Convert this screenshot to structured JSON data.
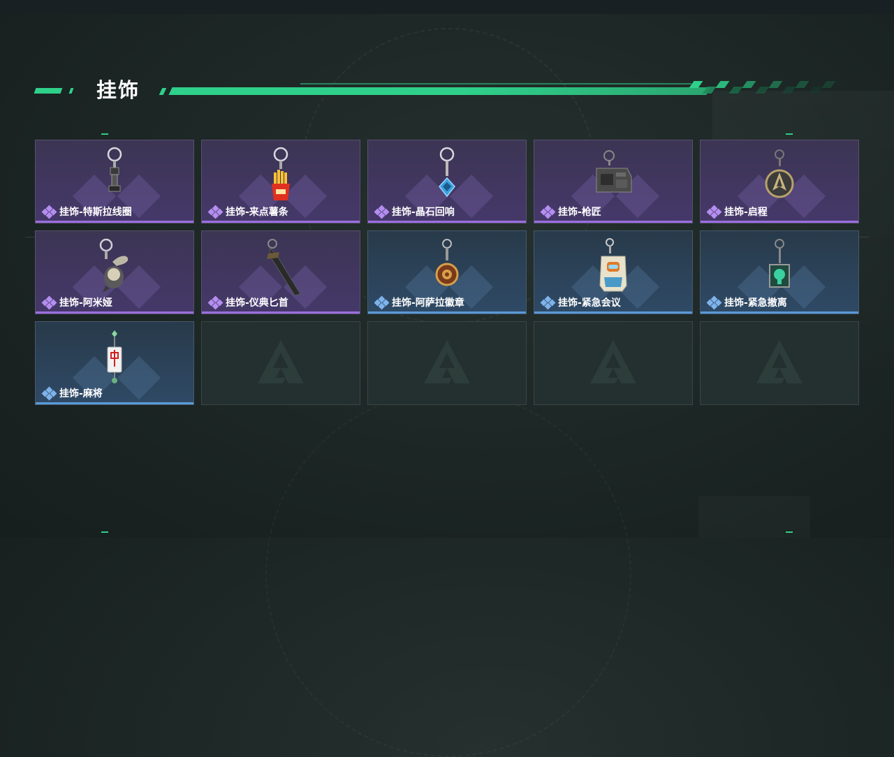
{
  "header": {
    "title": "挂饰",
    "accent": "#2fd08a"
  },
  "items": [
    {
      "name": "挂饰-特斯拉线圈",
      "rarity": "purple",
      "icon": "tesla-coil-charm-icon"
    },
    {
      "name": "挂饰-来点薯条",
      "rarity": "purple",
      "icon": "fries-charm-icon"
    },
    {
      "name": "挂饰-晶石回响",
      "rarity": "purple",
      "icon": "crystal-charm-icon"
    },
    {
      "name": "挂饰-枪匠",
      "rarity": "purple",
      "icon": "gunsmith-charm-icon"
    },
    {
      "name": "挂饰-启程",
      "rarity": "purple",
      "icon": "compass-charm-icon"
    },
    {
      "name": "挂饰-阿米娅",
      "rarity": "purple",
      "icon": "amiya-charm-icon"
    },
    {
      "name": "挂饰-仪典匕首",
      "rarity": "purple",
      "icon": "dagger-charm-icon"
    },
    {
      "name": "挂饰-阿萨拉徽章",
      "rarity": "blue",
      "icon": "badge-charm-icon"
    },
    {
      "name": "挂饰-紧急会议",
      "rarity": "blue",
      "icon": "meeting-charm-icon"
    },
    {
      "name": "挂饰-紧急撤离",
      "rarity": "blue",
      "icon": "evac-charm-icon"
    },
    {
      "name": "挂饰-麻将",
      "rarity": "blue",
      "icon": "mahjong-charm-icon"
    }
  ],
  "colors": {
    "purple": "#9b6fe0",
    "blue": "#5a9ad8",
    "empty": "#24302f"
  }
}
